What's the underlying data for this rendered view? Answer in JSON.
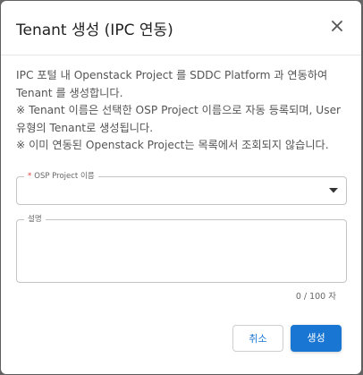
{
  "dialog": {
    "title": "Tenant 생성 (IPC 연동)",
    "description_lines": [
      "IPC 포털 내 Openstack Project 를 SDDC Platform 과 연동하여",
      "Tenant 를 생성합니다.",
      "※ Tenant 이름은 선택한 OSP Project 이름으로 자동 등록되며, User",
      "유형의 Tenant로 생성됩니다.",
      "※ 이미 연동된 Openstack Project는 목록에서 조회되지 않습니다."
    ]
  },
  "form": {
    "project_select": {
      "required_mark": "*",
      "label": "OSP Project 이름",
      "value": ""
    },
    "description_field": {
      "label": "설명",
      "value": ""
    },
    "char_counter": "0 / 100 자"
  },
  "buttons": {
    "cancel_label": "취소",
    "create_label": "생성"
  },
  "icons": {
    "close": "close-icon",
    "dropdown": "caret-down-icon"
  },
  "colors": {
    "primary": "#1976d2",
    "required": "#e53935"
  }
}
